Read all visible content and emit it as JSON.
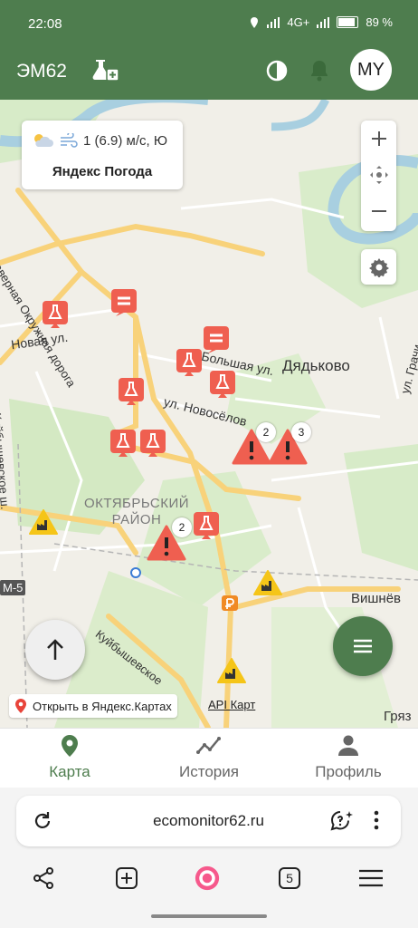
{
  "status_bar": {
    "time": "22:08",
    "network": "4G+",
    "battery": "89 %"
  },
  "app_bar": {
    "title": "ЭМ62",
    "avatar_initials": "MY"
  },
  "map": {
    "weather": {
      "wind": "1 (6.9) м/с, Ю",
      "title": "Яндекс Погода"
    },
    "labels": {
      "dyadkovo": "Дядьково",
      "oktyabrsky": "ОКТЯБРЬСКИЙ РАЙОН",
      "vishnevka": "Вишнёв",
      "novaya": "Новая ул.",
      "bolshaya": "Большая ул.",
      "novoselov": "ул. Новосёлов",
      "severnaya": "Северная Окружная дорога",
      "kuibyshevskoe1": "Куйбышевское ш.",
      "kuibyshevskoe2": "Куйбышевское",
      "grachi": "ул. Грачи",
      "m5": "М-5",
      "gryaz": "Гряз"
    },
    "badges": {
      "b1": "2",
      "b2": "3",
      "b3": "2"
    },
    "open_in_yandex": "Открыть в Яндекс.Картах",
    "api_link": "API Карт"
  },
  "bottom_nav": {
    "map": "Карта",
    "history": "История",
    "profile": "Профиль"
  },
  "browser": {
    "url": "ecomonitor62.ru",
    "tabs_count": "5"
  },
  "colors": {
    "brand_green": "#4e7d4e",
    "alert_red": "#ef5f50",
    "warning_yellow": "#f5c518"
  }
}
